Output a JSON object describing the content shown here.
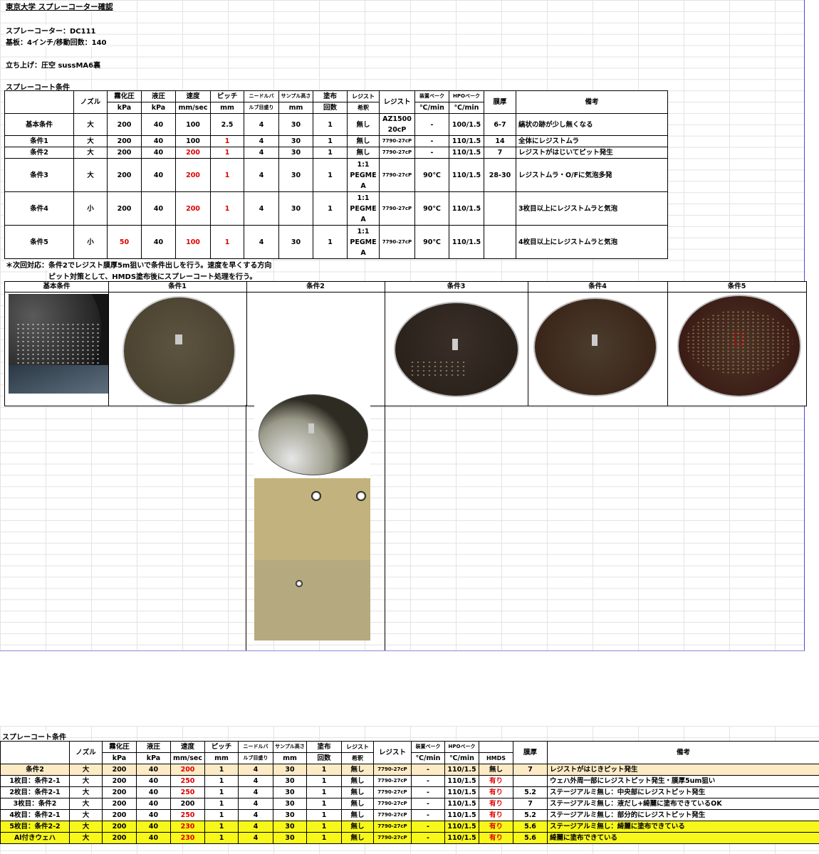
{
  "title": "東京大学 スプレーコーター確認",
  "info": {
    "coater": "スプレーコーター：DC111",
    "substrate": "基板：4インチ/移動回数：140",
    "setup": "立ち上げ：圧空 sussMA6裏"
  },
  "section1_title": "スプレーコート条件",
  "headers1": {
    "nozzle": "ノズル",
    "atomize": "霧化圧",
    "atomize_unit": "kPa",
    "liquid": "液圧",
    "liquid_unit": "kPa",
    "speed": "速度",
    "speed_unit": "mm/sec",
    "pitch": "ピッチ",
    "pitch_unit": "mm",
    "needle": "ニードルバ",
    "needle2": "ルブ目盛り",
    "height": "サンプル高さ",
    "height_unit": "mm",
    "coats": "塗布",
    "coats_unit": "回数",
    "dilution": "レジスト",
    "dilution2": "希釈",
    "resist": "レジスト",
    "bake": "装置ベーク",
    "bake_unit": "℃/min",
    "hpo": "HPOベーク",
    "hpo_unit": "℃/min",
    "thickness": "膜厚",
    "remarks": "備考"
  },
  "rows1": [
    {
      "name": "基本条件",
      "nozzle": "大",
      "atomize": "200",
      "liquid": "40",
      "speed": "100",
      "pitch": "2.5",
      "needle": "4",
      "height": "30",
      "coats": "1",
      "dilution": "無し",
      "resist": "AZ1500\n20cP",
      "bake": "-",
      "hpo": "100/1.5",
      "thickness": "6-7",
      "remarks": "縞状の跡が少し無くなる"
    },
    {
      "name": "条件1",
      "nozzle": "大",
      "atomize": "200",
      "liquid": "40",
      "speed": "100",
      "pitch": "1",
      "needle": "4",
      "height": "30",
      "coats": "1",
      "dilution": "無し",
      "resist": "7790-27cP",
      "bake": "-",
      "hpo": "110/1.5",
      "thickness": "14",
      "remarks": "全体にレジストムラ"
    },
    {
      "name": "条件2",
      "nozzle": "大",
      "atomize": "200",
      "liquid": "40",
      "speed": "200",
      "pitch": "1",
      "needle": "4",
      "height": "30",
      "coats": "1",
      "dilution": "無し",
      "resist": "7790-27cP",
      "bake": "-",
      "hpo": "110/1.5",
      "thickness": "7",
      "remarks": "レジストがはじいてピット発生"
    },
    {
      "name": "条件3",
      "nozzle": "大",
      "atomize": "200",
      "liquid": "40",
      "speed": "200",
      "pitch": "1",
      "needle": "4",
      "height": "30",
      "coats": "1",
      "dilution": "1:1\nPEGME\nA",
      "resist": "7790-27cP",
      "bake": "90℃",
      "hpo": "110/1.5",
      "thickness": "28-30",
      "remarks": "レジストムラ・O/Fに気泡多発"
    },
    {
      "name": "条件4",
      "nozzle": "小",
      "atomize": "200",
      "liquid": "40",
      "speed": "200",
      "pitch": "1",
      "needle": "4",
      "height": "30",
      "coats": "1",
      "dilution": "1:1\nPEGME\nA",
      "resist": "7790-27cP",
      "bake": "90℃",
      "hpo": "110/1.5",
      "thickness": "",
      "remarks": "3枚目以上にレジストムラと気泡"
    },
    {
      "name": "条件5",
      "nozzle": "小",
      "atomize": "50",
      "liquid": "40",
      "speed": "100",
      "pitch": "1",
      "needle": "4",
      "height": "30",
      "coats": "1",
      "dilution": "1:1\nPEGME\nA",
      "resist": "7790-27cP",
      "bake": "90℃",
      "hpo": "110/1.5",
      "thickness": "",
      "remarks": "4枚目以上にレジストムラと気泡"
    }
  ],
  "notes": [
    "＊次回対応：条件2でレジスト膜厚5m狙いで条件出しを行う。速度を早くする方向",
    "ピット対策として、HMDS塗布後にスプレーコート処理を行う。"
  ],
  "image_headers": [
    "基本条件",
    "条件1",
    "条件2",
    "条件3",
    "条件4",
    "条件5"
  ],
  "section2_title": "スプレーコート条件",
  "headers2_extra": {
    "hmds": "HMDS"
  },
  "rows2": [
    {
      "name": "条件2",
      "nozzle": "大",
      "atomize": "200",
      "liquid": "40",
      "speed": "200",
      "pitch": "1",
      "needle": "4",
      "height": "30",
      "coats": "1",
      "dilution": "無し",
      "resist": "7790-27cP",
      "bake": "-",
      "hpo": "110/1.5",
      "hmds": "無し",
      "thickness": "7",
      "remarks": "レジストがはじきピット発生"
    },
    {
      "name": "1枚目：条件2-1",
      "nozzle": "大",
      "atomize": "200",
      "liquid": "40",
      "speed": "250",
      "pitch": "1",
      "needle": "4",
      "height": "30",
      "coats": "1",
      "dilution": "無し",
      "resist": "7790-27cP",
      "bake": "-",
      "hpo": "110/1.5",
      "hmds": "有り",
      "thickness": "",
      "remarks": "ウェハ外周一部にレジストピット発生・膜厚5um狙い"
    },
    {
      "name": "2枚目：条件2-1",
      "nozzle": "大",
      "atomize": "200",
      "liquid": "40",
      "speed": "250",
      "pitch": "1",
      "needle": "4",
      "height": "30",
      "coats": "1",
      "dilution": "無し",
      "resist": "7790-27cP",
      "bake": "-",
      "hpo": "110/1.5",
      "hmds": "有り",
      "thickness": "5.2",
      "remarks": "ステージアルミ無し：中央部にレジストピット発生"
    },
    {
      "name": "3枚目：条件2",
      "nozzle": "大",
      "atomize": "200",
      "liquid": "40",
      "speed": "200",
      "pitch": "1",
      "needle": "4",
      "height": "30",
      "coats": "1",
      "dilution": "無し",
      "resist": "7790-27cP",
      "bake": "-",
      "hpo": "110/1.5",
      "hmds": "有り",
      "thickness": "7",
      "remarks": "ステージアルミ無し：液だし+綺麗に塗布できているOK"
    },
    {
      "name": "4枚目：条件2-1",
      "nozzle": "大",
      "atomize": "200",
      "liquid": "40",
      "speed": "250",
      "pitch": "1",
      "needle": "4",
      "height": "30",
      "coats": "1",
      "dilution": "無し",
      "resist": "7790-27cP",
      "bake": "-",
      "hpo": "110/1.5",
      "hmds": "有り",
      "thickness": "5.2",
      "remarks": "ステージアルミ無し：部分的にレジストピット発生"
    },
    {
      "name": "5枚目：条件2-2",
      "nozzle": "大",
      "atomize": "200",
      "liquid": "40",
      "speed": "230",
      "pitch": "1",
      "needle": "4",
      "height": "30",
      "coats": "1",
      "dilution": "無し",
      "resist": "7790-27cP",
      "bake": "-",
      "hpo": "110/1.5",
      "hmds": "有り",
      "thickness": "5.6",
      "remarks": "ステージアルミ無し：綺麗に塗布できている"
    },
    {
      "name": "Al付きウェハ",
      "nozzle": "大",
      "atomize": "200",
      "liquid": "40",
      "speed": "230",
      "pitch": "1",
      "needle": "4",
      "height": "30",
      "coats": "1",
      "dilution": "無し",
      "resist": "7790-27cP",
      "bake": "-",
      "hpo": "110/1.5",
      "hmds": "有り",
      "thickness": "5.6",
      "remarks": "綺麗に塗布できている"
    }
  ],
  "colors": {
    "red": "#e00000",
    "highlight_beige": "#fcebc5",
    "highlight_yellow": "#f7f719"
  }
}
